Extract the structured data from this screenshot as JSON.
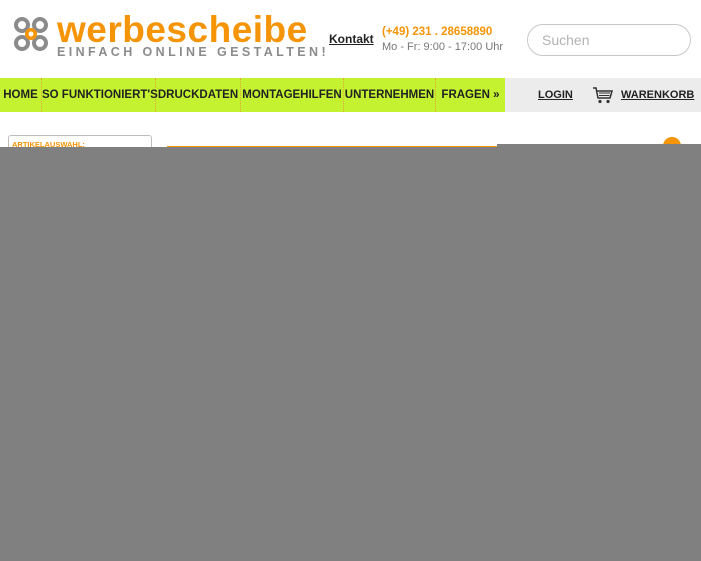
{
  "header": {
    "logo_text": "werbescheibe",
    "slogan": "EINFACH ONLINE GESTALTEN!",
    "contact_link": "Kontakt",
    "phone": "(+49) 231 . 28658890",
    "hours": "Mo - Fr: 9:00 - 17:00 Uhr",
    "search_placeholder": "Suchen"
  },
  "nav": {
    "items": [
      {
        "label": "HOME"
      },
      {
        "label": "SO FUNKTIONIERT'S"
      },
      {
        "label": "DRUCKDATEN"
      },
      {
        "label": "MONTAGEHILFEN"
      },
      {
        "label": "UNTERNEHMEN"
      },
      {
        "label": "FRAGEN »"
      }
    ],
    "login": "LOGIN",
    "cart": "WARENKORB"
  },
  "content": {
    "sidebar_label": "ARTIKELAUSWAHL:"
  },
  "colors": {
    "brand_orange": "#f49406",
    "nav_green": "#c5f230",
    "overlay_gray": "#808080"
  },
  "icons": [
    "logo-flower-icon",
    "cart-icon"
  ]
}
